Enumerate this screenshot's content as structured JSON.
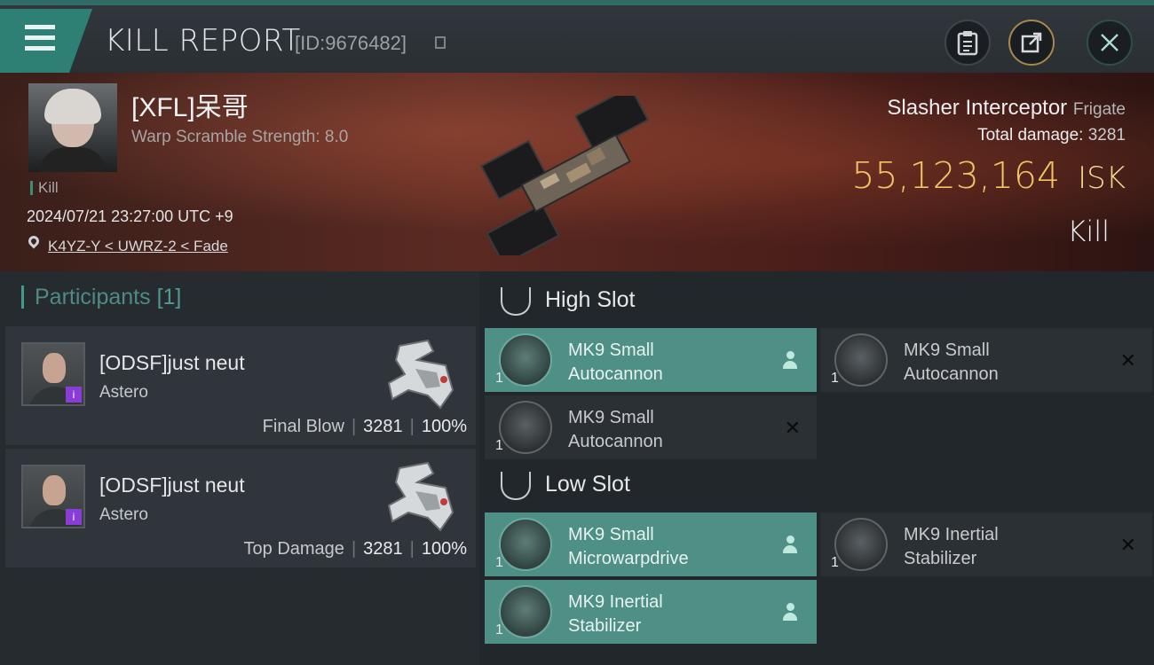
{
  "header": {
    "title": "KILL REPORT",
    "report_id": "[ID:9676482]",
    "buttons": [
      {
        "name": "clipboard-icon",
        "label": ""
      },
      {
        "name": "share-icon",
        "label": ""
      },
      {
        "name": "close-icon",
        "label": ""
      }
    ]
  },
  "victim": {
    "name": "[XFL]呆哥",
    "warp_scramble": "Warp Scramble Strength: 8.0",
    "kill_tag": "Kill",
    "datetime": "2024/07/21 23:27:00 UTC +9",
    "location": "K4YZ-Y < UWRZ-2 < Fade",
    "ship_name": "Slasher Interceptor",
    "ship_class": "Frigate",
    "total_damage_label": "Total damage:",
    "total_damage": "3281",
    "isk_value": "55,123,164",
    "isk_unit": "ISK",
    "status": "Kill"
  },
  "participants": {
    "label": "Participants",
    "count": "[1]",
    "rows": [
      {
        "name": "[ODSF]just neut",
        "ship": "Astero",
        "badge": "i",
        "role": "Final Blow",
        "damage": "3281",
        "percent": "100%"
      },
      {
        "name": "[ODSF]just neut",
        "ship": "Astero",
        "badge": "i",
        "role": "Top Damage",
        "damage": "3281",
        "percent": "100%"
      }
    ]
  },
  "slots": [
    {
      "title": "High Slot",
      "modules": [
        {
          "name_line1": "MK9 Small",
          "name_line2": "Autocannon",
          "qty": "1",
          "state": "fit"
        },
        {
          "name_line1": "MK9 Small",
          "name_line2": "Autocannon",
          "qty": "1",
          "state": "destroyed"
        },
        {
          "name_line1": "MK9 Small",
          "name_line2": "Autocannon",
          "qty": "1",
          "state": "destroyed"
        }
      ]
    },
    {
      "title": "Low Slot",
      "modules": [
        {
          "name_line1": "MK9 Small",
          "name_line2": "Microwarpdrive",
          "qty": "1",
          "state": "fit"
        },
        {
          "name_line1": "MK9 Inertial",
          "name_line2": "Stabilizer",
          "qty": "1",
          "state": "destroyed"
        },
        {
          "name_line1": "MK9 Inertial",
          "name_line2": "Stabilizer",
          "qty": "1",
          "state": "fit"
        }
      ]
    }
  ],
  "colors": {
    "accent_teal": "#4e8f86",
    "isk_gold": "#f2c266",
    "header_teal": "#2e8074"
  }
}
